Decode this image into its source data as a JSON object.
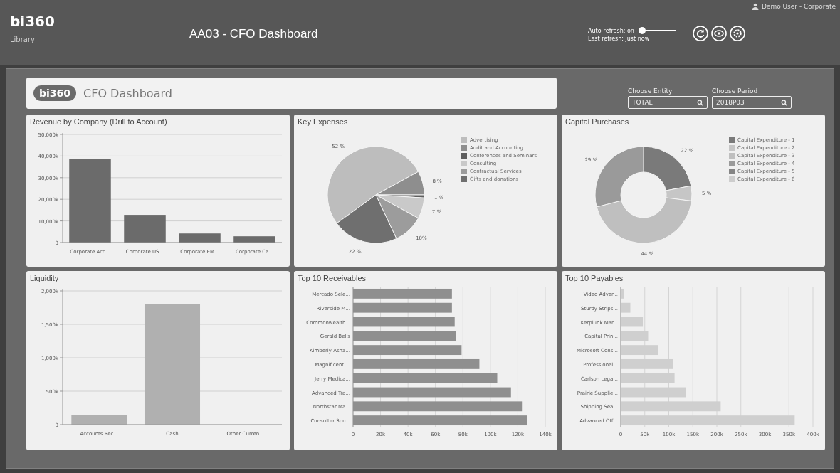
{
  "header": {
    "logo": "bi360",
    "library_link": "Library",
    "title": "AA03 - CFO Dashboard",
    "auto_refresh": {
      "label": "Auto-refresh: on",
      "on": true
    },
    "last_refresh": "Last refresh: just now",
    "user": "Demo User - Corporate"
  },
  "banner": {
    "logo": "bi360",
    "title": "CFO Dashboard"
  },
  "filters": [
    {
      "label": "Choose Entity",
      "value": "TOTAL"
    },
    {
      "label": "Choose Period",
      "value": "2018P03"
    }
  ],
  "panels": [
    {
      "title": "Revenue by Company (Drill to Account)",
      "chart_data": {
        "type": "bar",
        "categories": [
          "Corporate Acc...",
          "Corporate US...",
          "Corporate EM...",
          "Corporate Ca..."
        ],
        "values": [
          38500,
          12800,
          4200,
          2900
        ],
        "colors": [
          "#6b6b6b",
          "#6b6b6b",
          "#6b6b6b",
          "#6b6b6b"
        ],
        "grid": true,
        "ylim": [
          0,
          50000
        ],
        "yticks": [
          {
            "value": 0,
            "label": "0"
          },
          {
            "value": 10000,
            "label": "10,000k"
          },
          {
            "value": 20000,
            "label": "20,000k"
          },
          {
            "value": 30000,
            "label": "30,000k"
          },
          {
            "value": 40000,
            "label": "40,000k"
          },
          {
            "value": 50000,
            "label": "50,000k"
          }
        ]
      }
    },
    {
      "title": "Key Expenses",
      "chart_data": {
        "type": "pie",
        "categories": [
          "Advertising",
          "Audit and Accounting",
          "Conferences and Seminars",
          "Consulting",
          "Contractual Services",
          "Gifts and donations"
        ],
        "values": [
          52,
          8,
          1,
          7,
          10,
          22
        ],
        "colors": [
          "#bdbdbd",
          "#8e8e8e",
          "#5e5e5e",
          "#c9c9c9",
          "#9c9c9c",
          "#6f6f6f"
        ],
        "legend": true,
        "value_labels": [
          "52 %",
          "8 %",
          "1 %",
          "7 %",
          "10%",
          "22 %"
        ]
      }
    },
    {
      "title": "Capital Purchases",
      "chart_data": {
        "type": "donut",
        "categories": [
          "Capital Expenditure - 1",
          "Capital Expenditure - 2",
          "Capital Expenditure - 3",
          "Capital Expenditure - 4",
          "Capital Expenditure - 5",
          "Capital Expenditure - 6"
        ],
        "values": [
          22,
          5,
          44,
          29,
          null,
          null
        ],
        "colors": [
          "#7a7a7a",
          "#c6c6c6",
          "#bfbfbf",
          "#9a9a9a",
          "#858585",
          "#cdcdcd"
        ],
        "legend": true,
        "value_labels": [
          "22 %",
          "5 %",
          "44 %",
          "29 %",
          null,
          null
        ]
      }
    },
    {
      "title": "Liquidity",
      "chart_data": {
        "type": "bar",
        "categories": [
          "Accounts Rec...",
          "Cash",
          "Other Curren..."
        ],
        "values": [
          140,
          1800,
          0
        ],
        "colors": [
          "#b0b0b0",
          "#b0b0b0",
          "#b0b0b0"
        ],
        "grid": true,
        "ylim": [
          0,
          2000
        ],
        "yticks": [
          {
            "value": 0,
            "label": "0"
          },
          {
            "value": 500,
            "label": "500k"
          },
          {
            "value": 1000,
            "label": "1,000k"
          },
          {
            "value": 1500,
            "label": "1,500k"
          },
          {
            "value": 2000,
            "label": "2,000k"
          }
        ]
      }
    },
    {
      "title": "Top 10 Receivables",
      "chart_data": {
        "type": "bar",
        "orientation": "horizontal",
        "categories": [
          "Mercado Sele...",
          "Riverside M...",
          "Commonwealth...",
          "Gerald Bells",
          "Kimberly Asha...",
          "Magnificent ...",
          "Jerry Medica...",
          "Advanced Tra...",
          "Northstar Ma...",
          "Consulter Spo..."
        ],
        "values": [
          72,
          72,
          74,
          75,
          79,
          92,
          105,
          115,
          123,
          127
        ],
        "colors": [
          "#8f8f8f",
          "#8f8f8f",
          "#8f8f8f",
          "#8f8f8f",
          "#8f8f8f",
          "#8f8f8f",
          "#8f8f8f",
          "#8f8f8f",
          "#8f8f8f",
          "#8f8f8f"
        ],
        "grid": true,
        "xlim": [
          0,
          140
        ],
        "xticks": [
          {
            "value": 0,
            "label": "0"
          },
          {
            "value": 20,
            "label": "20k"
          },
          {
            "value": 40,
            "label": "40k"
          },
          {
            "value": 60,
            "label": "60k"
          },
          {
            "value": 80,
            "label": "80k"
          },
          {
            "value": 100,
            "label": "100k"
          },
          {
            "value": 120,
            "label": "120k"
          },
          {
            "value": 140,
            "label": "140k"
          }
        ]
      }
    },
    {
      "title": "Top 10 Payables",
      "chart_data": {
        "type": "bar",
        "orientation": "horizontal",
        "categories": [
          "Video Adver...",
          "Sturdy Strips...",
          "Kerplunk Mar...",
          "Capital Prin...",
          "Microsoft Cons...",
          "Professional...",
          "Carlson Lega...",
          "Prairie Supplie...",
          "Shipping Sea...",
          "Advanced Off..."
        ],
        "values": [
          6,
          20,
          46,
          57,
          78,
          109,
          112,
          135,
          208,
          362
        ],
        "colors": [
          "#cfcfcf",
          "#cfcfcf",
          "#cfcfcf",
          "#cfcfcf",
          "#cfcfcf",
          "#cfcfcf",
          "#cfcfcf",
          "#cfcfcf",
          "#cfcfcf",
          "#cfcfcf"
        ],
        "grid": true,
        "xlim": [
          0,
          400
        ],
        "xticks": [
          {
            "value": 0,
            "label": "0"
          },
          {
            "value": 50,
            "label": "50k"
          },
          {
            "value": 100,
            "label": "100k"
          },
          {
            "value": 150,
            "label": "150k"
          },
          {
            "value": 200,
            "label": "200k"
          },
          {
            "value": 250,
            "label": "250k"
          },
          {
            "value": 300,
            "label": "300k"
          },
          {
            "value": 350,
            "label": "350k"
          },
          {
            "value": 400,
            "label": "400k"
          }
        ]
      }
    }
  ]
}
